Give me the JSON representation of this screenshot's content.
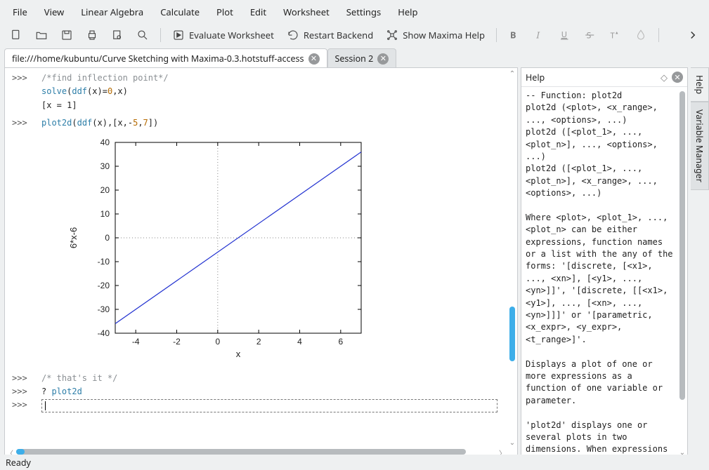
{
  "menu": {
    "items": [
      "File",
      "View",
      "Linear Algebra",
      "Calculate",
      "Plot",
      "Edit",
      "Worksheet",
      "Settings",
      "Help"
    ]
  },
  "toolbar": {
    "evaluate": "Evaluate Worksheet",
    "restart": "Restart Backend",
    "showhelp": "Show Maxima Help"
  },
  "tabs": {
    "active": "file:///home/kubuntu/Curve Sketching with Maxima-0.3.hotstuff-access",
    "second": "Session 2"
  },
  "worksheet": {
    "prompt": ">>>",
    "line1_comment": "/*find inflection point*/",
    "line2_a": "solve",
    "line2_b": "(",
    "line2_c": "ddf",
    "line2_d": "(x)=",
    "line2_e": "0",
    "line2_f": ",x)",
    "out1": "[x = 1]",
    "line3_a": "plot2d",
    "line3_b": "(",
    "line3_c": "ddf",
    "line3_d": "(x),[x,-",
    "line3_e": "5",
    "line3_f": ",",
    "line3_g": "7",
    "line3_h": "])",
    "line4_comment": "/* that's it */",
    "line5_a": "? ",
    "line5_b": "plot2d"
  },
  "chart_data": {
    "type": "line",
    "title": "",
    "xlabel": "x",
    "ylabel": "6*x-6",
    "xlim": [
      -5,
      7
    ],
    "ylim": [
      -40,
      40
    ],
    "xticks": [
      -4,
      -2,
      0,
      2,
      4,
      6
    ],
    "yticks": [
      -40,
      -30,
      -20,
      -10,
      0,
      10,
      20,
      30,
      40
    ],
    "series": [
      {
        "name": "6*x-6",
        "x": [
          -5,
          7
        ],
        "y": [
          -36,
          36
        ],
        "color": "#2030d0"
      }
    ]
  },
  "help": {
    "title": "Help",
    "body": "-- Function: plot2d\nplot2d (<plot>, <x_range>, ..., <options>, ...)\nplot2d ([<plot_1>, ..., <plot_n>], ..., <options>, ...)\nplot2d ([<plot_1>, ..., <plot_n>], <x_range>, ..., <options>, ...)\n\nWhere <plot>, <plot_1>, ..., <plot_n> can be either expressions, function names or a list with the any of the forms: '[discrete, [<x1>, ..., <xn>], [<y1>, ..., <yn>]]', '[discrete, [[<x1>, <y1>], ..., [<xn>, ..., <yn>]]]' or '[parametric, <x_expr>, <y_expr>, <t_range>]'.\n\nDisplays a plot of one or more expressions as a function of one variable or parameter.\n\n'plot2d' displays one or several plots in two dimensions. When expressions or function"
  },
  "sidetabs": {
    "help": "Help",
    "varmgr": "Variable Manager"
  },
  "status": {
    "text": "Ready"
  }
}
